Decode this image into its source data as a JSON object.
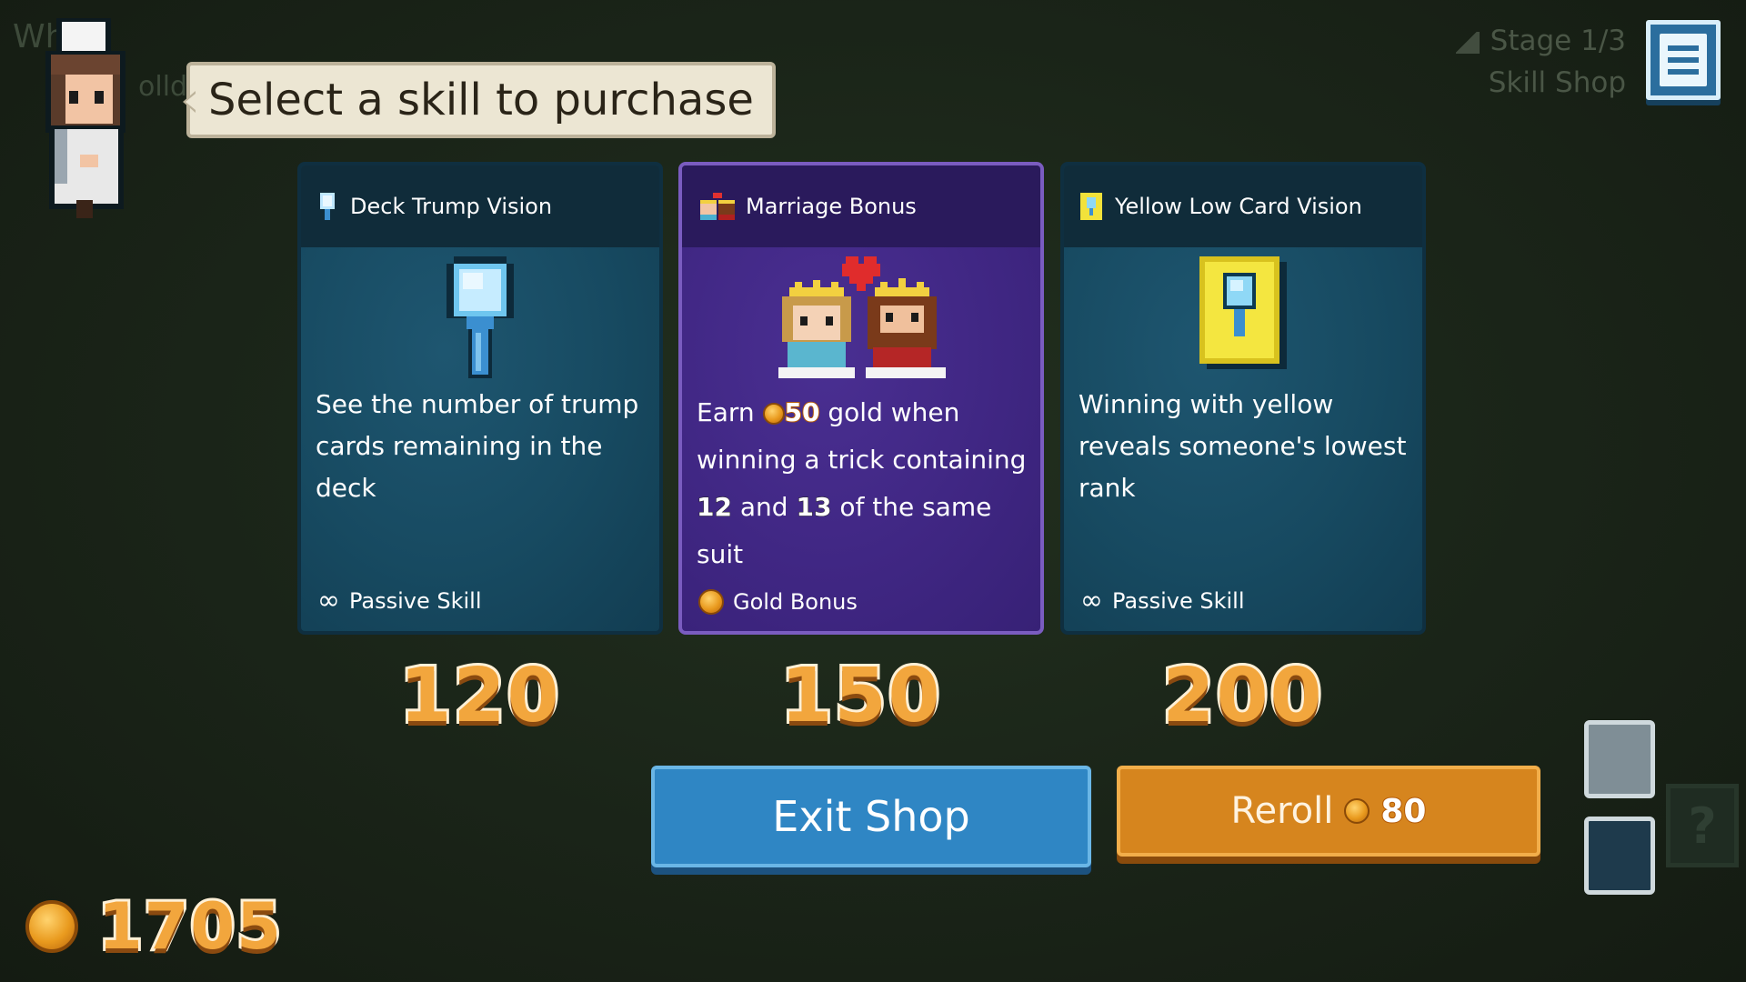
{
  "background_text": {
    "top_left_1": "Wh",
    "top_left_2": "olld"
  },
  "stage": {
    "stage_label": "Stage 1/3",
    "location": "Skill Shop"
  },
  "speech_bubble": {
    "text": "Select a skill to purchase"
  },
  "cards": [
    {
      "title": "Deck Trump Vision",
      "icon": "magnifier-icon",
      "description": "See the number of trump cards remaining in the deck",
      "footer": "Passive Skill",
      "footer_icon": "infinity-icon",
      "price": "120",
      "theme": "teal"
    },
    {
      "title": "Marriage Bonus",
      "icon": "king-queen-icon",
      "desc_parts": {
        "earn": "Earn",
        "amount": "50",
        "rest1": "gold when",
        "line2": "winning a trick containing",
        "n1": "12",
        "and": "and",
        "n2": "13",
        "rest3": "of the same suit"
      },
      "footer": "Gold Bonus",
      "footer_icon": "coin-icon",
      "price": "150",
      "theme": "purple"
    },
    {
      "title": "Yellow Low Card Vision",
      "icon": "yellow-card-magnifier-icon",
      "description": "Winning with yellow reveals someone's lowest rank",
      "footer": "Passive Skill",
      "footer_icon": "infinity-icon",
      "price": "200",
      "theme": "teal"
    }
  ],
  "buttons": {
    "exit": "Exit Shop",
    "reroll": "Reroll",
    "reroll_cost": "80"
  },
  "gold": {
    "total": "1705"
  },
  "ghost_slot": {
    "label": "?"
  },
  "colors": {
    "teal_card": "#174a61",
    "purple_card": "#3f2682",
    "exit_blue": "#2f86c4",
    "reroll_orange": "#d6851e",
    "gold": "#f2a63d"
  }
}
